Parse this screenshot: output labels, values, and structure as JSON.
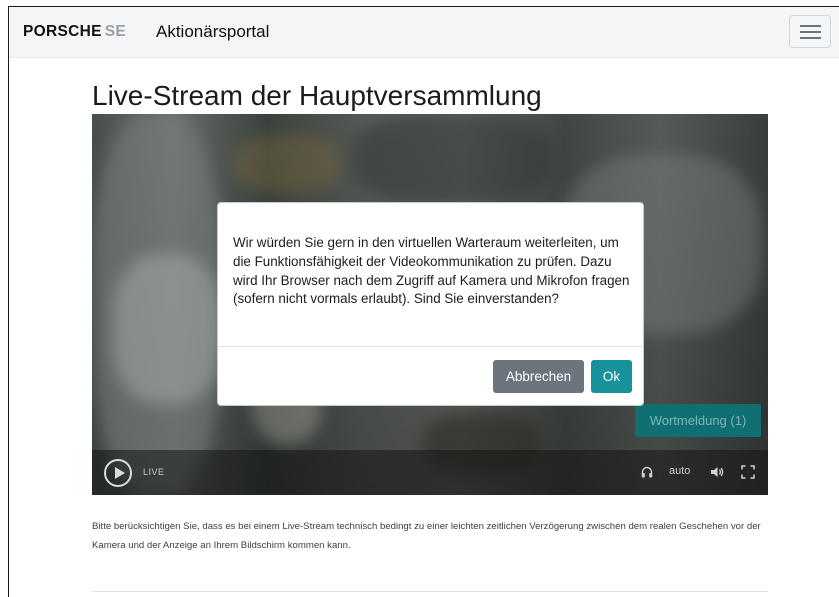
{
  "header": {
    "brand_main": "PORSCHE",
    "brand_suffix": "SE",
    "portal_title": "Aktionärsportal",
    "menu_icon": "hamburger-icon"
  },
  "page": {
    "title": "Live-Stream der Hauptversammlung"
  },
  "player": {
    "play_icon": "play-icon",
    "live_label": "LIVE",
    "audio_icon": "headphones-icon",
    "quality_label": "auto",
    "volume_icon": "volume-icon",
    "fullscreen_icon": "fullscreen-icon",
    "wortmeldung_label": "Wortmeldung (1)"
  },
  "dialog": {
    "message": "Wir würden Sie gern in den virtuellen Warteraum weiterleiten, um die Funktionsfähigkeit der Videokommunikation zu prüfen. Dazu wird Ihr Browser nach dem Zugriff auf Kamera und Mikrofon fragen (sofern nicht vormals erlaubt). Sind Sie einverstanden?",
    "cancel_label": "Abbrechen",
    "ok_label": "Ok"
  },
  "notice": {
    "text": "Bitte berücksichtigen Sie, dass es bei einem Live-Stream technisch bedingt zu einer leichten zeitlichen Verzögerung zwischen dem realen Geschehen vor der Kamera und der Anzeige an Ihrem Bildschirm kommen kann."
  },
  "colors": {
    "navbar_bg": "#f4f5f6",
    "accent": "#17929b",
    "cancel_button": "#6c757d",
    "wortmeldung_bg": "#0f6f73"
  }
}
